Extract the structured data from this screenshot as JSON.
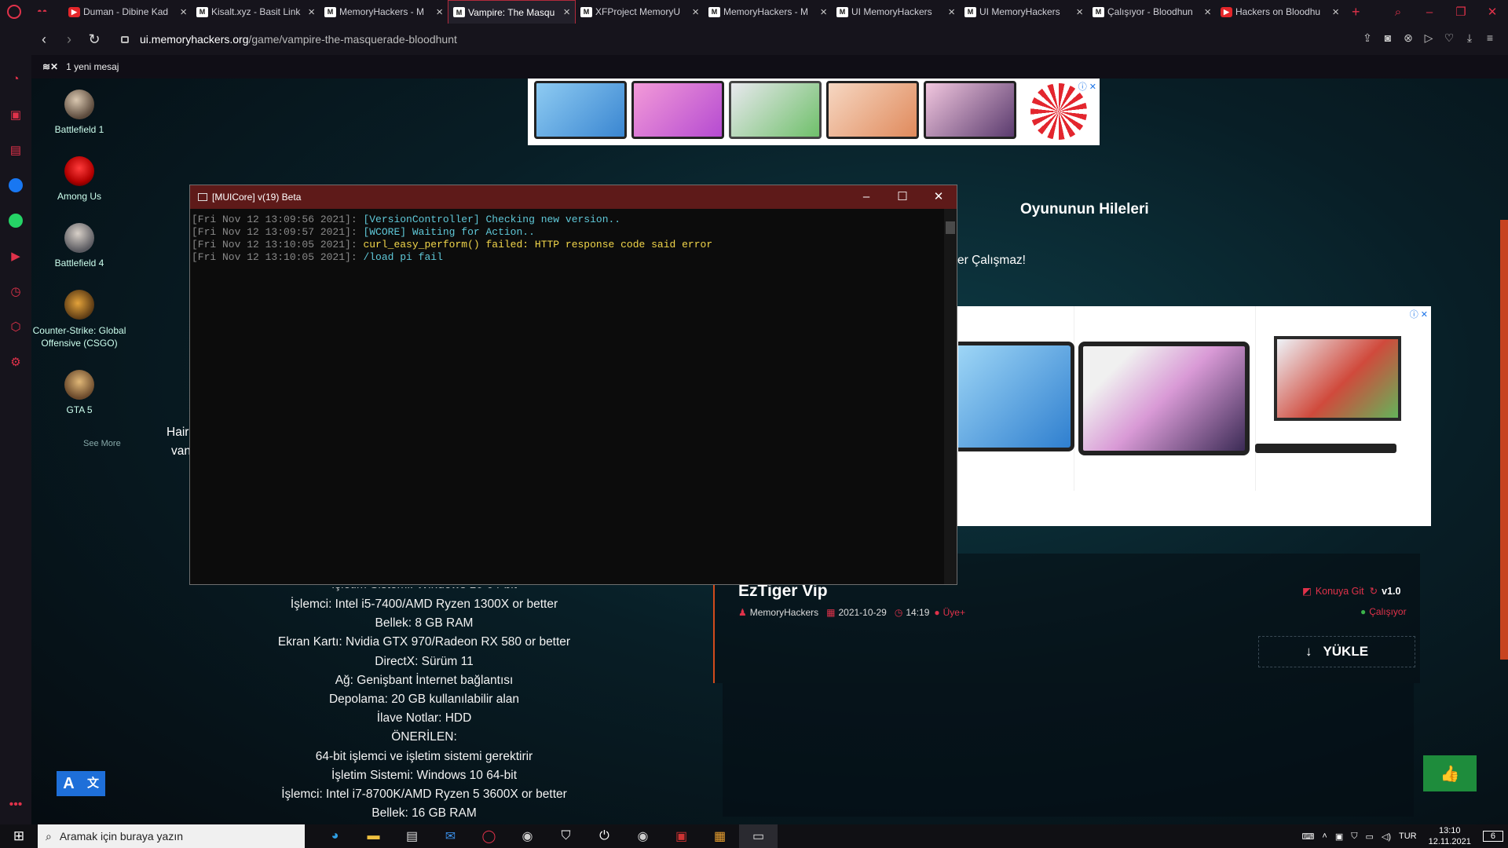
{
  "browser": {
    "tabs": [
      {
        "title": "Duman - Dibine Kad",
        "fav": "yt",
        "active": false
      },
      {
        "title": "Kisalt.xyz - Basit Link",
        "fav": "m",
        "active": false
      },
      {
        "title": "MemoryHackers - M",
        "fav": "m",
        "active": false
      },
      {
        "title": "Vampire: The Masqu",
        "fav": "m",
        "active": true
      },
      {
        "title": "XFProject MemoryU",
        "fav": "m",
        "active": false
      },
      {
        "title": "MemoryHackers - M",
        "fav": "m",
        "active": false
      },
      {
        "title": "UI MemoryHackers",
        "fav": "m",
        "active": false
      },
      {
        "title": "UI MemoryHackers",
        "fav": "m",
        "active": false
      },
      {
        "title": "Çalışıyor - Bloodhun",
        "fav": "m",
        "active": false
      },
      {
        "title": "Hackers on Bloodhu",
        "fav": "yt",
        "active": false
      }
    ],
    "url_domain": "ui.memoryhackers.org",
    "url_path": "/game/vampire-the-masquerade-bloodhunt",
    "message_notice": "1 yeni mesaj",
    "accent": "#e0324a"
  },
  "games": [
    {
      "name": "Battlefield 1"
    },
    {
      "name": "Among Us"
    },
    {
      "name": "Battlefield 4"
    },
    {
      "name": "Counter-Strike: Global Offensive (CSGO)"
    },
    {
      "name": "GTA 5"
    }
  ],
  "see_more": "See More",
  "console": {
    "title": "[MUICore] v(19) Beta",
    "lines": [
      {
        "ts": "[Fri Nov 12 13:09:56 2021]:",
        "msg": "[VersionController] Checking new version..",
        "color": "cyan"
      },
      {
        "ts": "[Fri Nov 12 13:09:57 2021]:",
        "msg": "[WCORE] Waiting for Action..",
        "color": "cyan"
      },
      {
        "ts": "[Fri Nov 12 13:10:05 2021]:",
        "msg": "curl_easy_perform() failed: HTTP response code said error",
        "color": "yellow"
      },
      {
        "ts": "[Fri Nov 12 13:10:05 2021]:",
        "msg": "/load pi fail",
        "color": "cyan"
      }
    ]
  },
  "page": {
    "heading": "Oyununun Hileleri",
    "partial_notice": "er Çalışmaz!",
    "partial_left1": "Hair",
    "partial_left2": "van",
    "requirements": [
      "İşlemci: Intel i5-7400/AMD Ryzen 1300X or better",
      "Bellek: 8 GB RAM",
      "Ekran Kartı: Nvidia GTX 970/Radeon RX 580 or better",
      "DirectX: Sürüm 11",
      "Ağ: Genişbant İnternet bağlantısı",
      "Depolama: 20 GB kullanılabilir alan",
      "İlave Notlar: HDD",
      "ÖNERİLEN:",
      "64-bit işlemci ve işletim sistemi gerektirir",
      "İşletim Sistemi: Windows 10 64-bit",
      "İşlemci: Intel i7-8700K/AMD Ryzen 5 3600X or better",
      "Bellek: 16 GB RAM"
    ],
    "partial_req_top": "İşletim Sistemi: Windows 10 64-bit"
  },
  "cheat": {
    "title": "EzTiger Vip",
    "author": "MemoryHackers",
    "date": "2021-10-29",
    "time": "14:19",
    "access": "Üye+",
    "topic_link": "Konuya Git",
    "version": "v1.0",
    "status": "Çalışıyor",
    "download": "YÜKLE"
  },
  "taskbar": {
    "search_placeholder": "Aramak için buraya yazın",
    "lang": "TUR",
    "time": "13:10",
    "date": "12.11.2021",
    "notifications": "6"
  }
}
